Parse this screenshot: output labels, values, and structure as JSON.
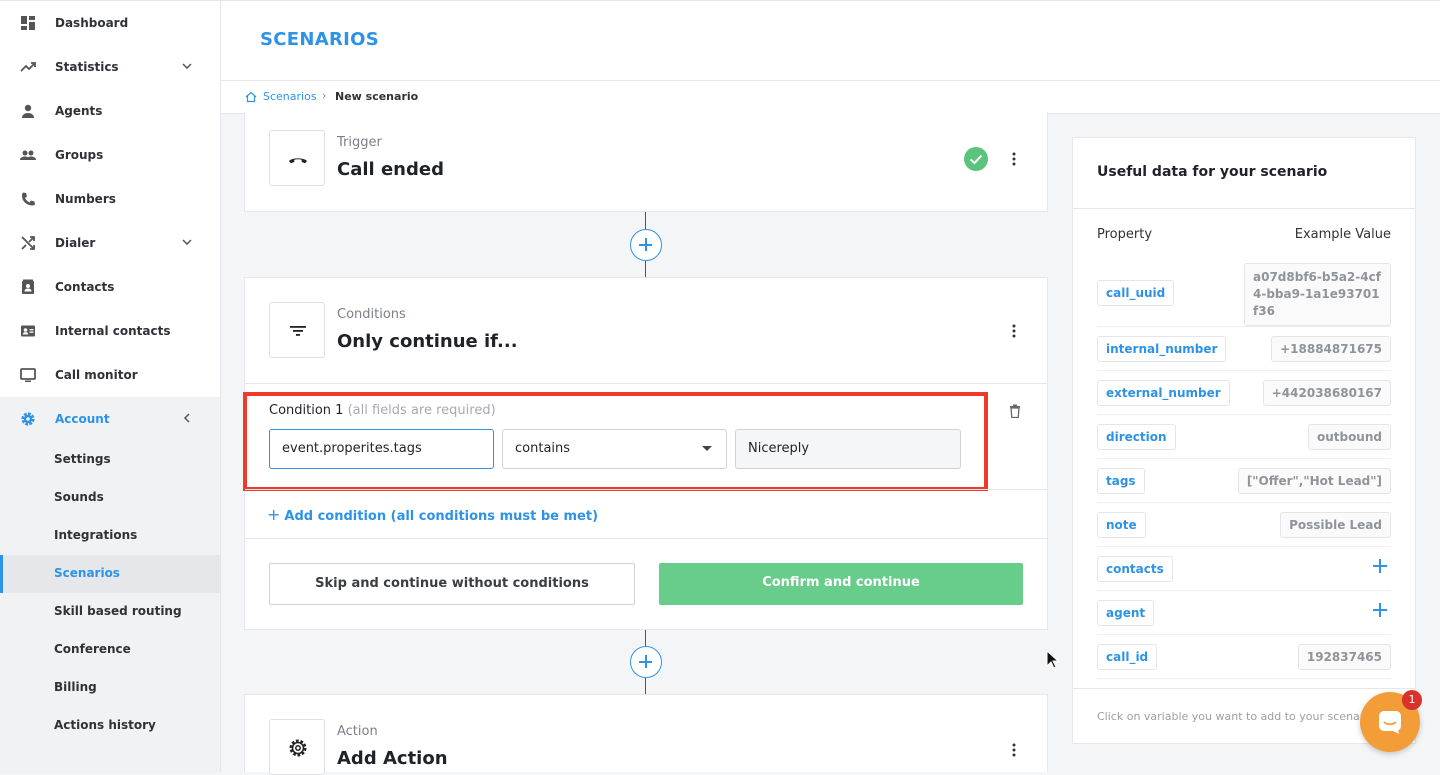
{
  "sidebar": {
    "items": [
      {
        "label": "Dashboard",
        "icon": "dashboard-icon"
      },
      {
        "label": "Statistics",
        "icon": "trending-up-icon"
      },
      {
        "label": "Agents",
        "icon": "person-icon"
      },
      {
        "label": "Groups",
        "icon": "people-icon"
      },
      {
        "label": "Numbers",
        "icon": "phone-icon"
      },
      {
        "label": "Dialer",
        "icon": "shuffle-icon"
      },
      {
        "label": "Contacts",
        "icon": "contacts-icon"
      },
      {
        "label": "Internal contacts",
        "icon": "id-card-icon"
      },
      {
        "label": "Call monitor",
        "icon": "monitor-icon"
      },
      {
        "label": "Account",
        "icon": "gear-icon"
      }
    ],
    "subitems": [
      "Settings",
      "Sounds",
      "Integrations",
      "Scenarios",
      "Skill based routing",
      "Conference",
      "Billing",
      "Actions history"
    ],
    "active_subitem": "Scenarios",
    "accent_color": "#2e93e6"
  },
  "header": {
    "title": "SCENARIOS"
  },
  "breadcrumb": {
    "root": "Scenarios",
    "sep": "›",
    "current": "New scenario"
  },
  "trigger": {
    "label": "Trigger",
    "title": "Call ended",
    "status": "complete"
  },
  "conditions": {
    "label": "Conditions",
    "title": "Only continue if...",
    "condition_label": "Condition 1",
    "condition_hint": "(all fields are required)",
    "field_value": "event.properites.tags",
    "operator_value": "contains",
    "match_value": "Nicereply",
    "add_condition": "Add condition (all conditions must be met)",
    "skip_button": "Skip and continue without conditions",
    "confirm_button": "Confirm and continue",
    "confirm_color": "#68cc8b",
    "highlight_color": "#ee3b2b"
  },
  "action": {
    "label": "Action",
    "title": "Add Action"
  },
  "useful_data": {
    "title": "Useful data for your scenario",
    "col_property": "Property",
    "col_example": "Example Value",
    "rows": [
      {
        "name": "call_uuid",
        "value": "a07d8bf6-b5a2-4cf4-bba9-1a1e93701f36"
      },
      {
        "name": "internal_number",
        "value": "+18884871675"
      },
      {
        "name": "external_number",
        "value": "+442038680167"
      },
      {
        "name": "direction",
        "value": "outbound"
      },
      {
        "name": "tags",
        "value": "[\"Offer\",\"Hot Lead\"]"
      },
      {
        "name": "note",
        "value": "Possible Lead"
      },
      {
        "name": "contacts",
        "value": null
      },
      {
        "name": "agent",
        "value": null
      },
      {
        "name": "call_id",
        "value": "192837465"
      }
    ],
    "footer": "Click on variable you want to add to your scenario"
  },
  "chat": {
    "badge": "1",
    "color": "#f29d38"
  }
}
